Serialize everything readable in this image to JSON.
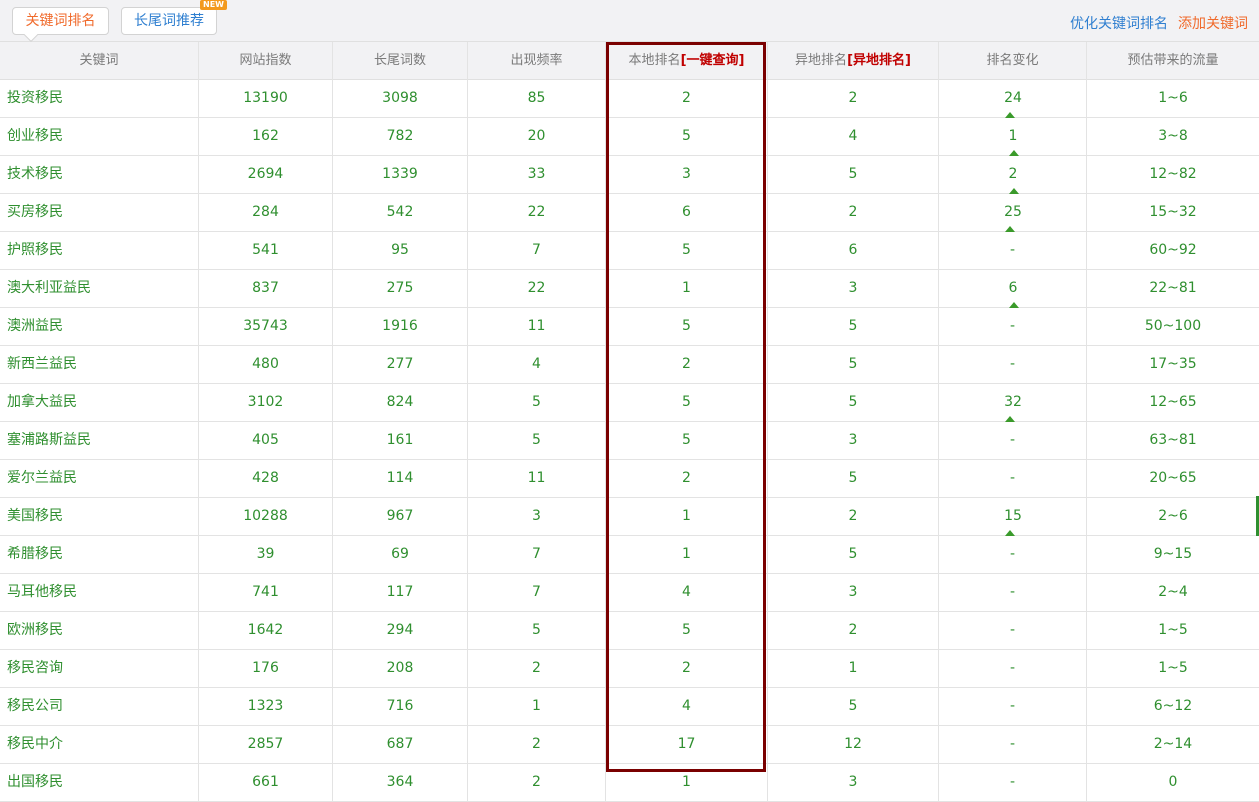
{
  "tabs": [
    {
      "label": "关键词排名",
      "active": true
    },
    {
      "label": "长尾词推荐",
      "badge": "NEW",
      "active": false
    }
  ],
  "top_links": {
    "optimize": "优化关键词排名",
    "add": "添加关键词"
  },
  "columns": [
    {
      "label": "关键词"
    },
    {
      "label": "网站指数"
    },
    {
      "label": "长尾词数"
    },
    {
      "label": "出现频率"
    },
    {
      "label": "本地排名",
      "link": "[一键查询]"
    },
    {
      "label": "异地排名",
      "link": "[异地排名]"
    },
    {
      "label": "排名变化"
    },
    {
      "label": "预估带来的流量"
    }
  ],
  "rows": [
    {
      "kw": "投资移民",
      "index": "13190",
      "longtail": "3098",
      "freq": "85",
      "local": "2",
      "remote": "2",
      "change": "24",
      "up": true,
      "traffic": "1~6"
    },
    {
      "kw": "创业移民",
      "index": "162",
      "longtail": "782",
      "freq": "20",
      "local": "5",
      "remote": "4",
      "change": "1",
      "up": true,
      "traffic": "3~8"
    },
    {
      "kw": "技术移民",
      "index": "2694",
      "longtail": "1339",
      "freq": "33",
      "local": "3",
      "remote": "5",
      "change": "2",
      "up": true,
      "traffic": "12~82"
    },
    {
      "kw": "买房移民",
      "index": "284",
      "longtail": "542",
      "freq": "22",
      "local": "6",
      "remote": "2",
      "change": "25",
      "up": true,
      "traffic": "15~32"
    },
    {
      "kw": "护照移民",
      "index": "541",
      "longtail": "95",
      "freq": "7",
      "local": "5",
      "remote": "6",
      "change": "-",
      "up": false,
      "traffic": "60~92"
    },
    {
      "kw": "澳大利亚益民",
      "index": "837",
      "longtail": "275",
      "freq": "22",
      "local": "1",
      "remote": "3",
      "change": "6",
      "up": true,
      "traffic": "22~81"
    },
    {
      "kw": "澳洲益民",
      "index": "35743",
      "longtail": "1916",
      "freq": "11",
      "local": "5",
      "remote": "5",
      "change": "-",
      "up": false,
      "traffic": "50~100"
    },
    {
      "kw": "新西兰益民",
      "index": "480",
      "longtail": "277",
      "freq": "4",
      "local": "2",
      "remote": "5",
      "change": "-",
      "up": false,
      "traffic": "17~35"
    },
    {
      "kw": "加拿大益民",
      "index": "3102",
      "longtail": "824",
      "freq": "5",
      "local": "5",
      "remote": "5",
      "change": "32",
      "up": true,
      "traffic": "12~65"
    },
    {
      "kw": "塞浦路斯益民",
      "index": "405",
      "longtail": "161",
      "freq": "5",
      "local": "5",
      "remote": "3",
      "change": "-",
      "up": false,
      "traffic": "63~81"
    },
    {
      "kw": "爱尔兰益民",
      "index": "428",
      "longtail": "114",
      "freq": "11",
      "local": "2",
      "remote": "5",
      "change": "-",
      "up": false,
      "traffic": "20~65"
    },
    {
      "kw": "美国移民",
      "index": "10288",
      "longtail": "967",
      "freq": "3",
      "local": "1",
      "remote": "2",
      "change": "15",
      "up": true,
      "traffic": "2~6"
    },
    {
      "kw": "希腊移民",
      "index": "39",
      "longtail": "69",
      "freq": "7",
      "local": "1",
      "remote": "5",
      "change": "-",
      "up": false,
      "traffic": "9~15"
    },
    {
      "kw": "马耳他移民",
      "index": "741",
      "longtail": "117",
      "freq": "7",
      "local": "4",
      "remote": "3",
      "change": "-",
      "up": false,
      "traffic": "2~4"
    },
    {
      "kw": "欧洲移民",
      "index": "1642",
      "longtail": "294",
      "freq": "5",
      "local": "5",
      "remote": "2",
      "change": "-",
      "up": false,
      "traffic": "1~5"
    },
    {
      "kw": "移民咨询",
      "index": "176",
      "longtail": "208",
      "freq": "2",
      "local": "2",
      "remote": "1",
      "change": "-",
      "up": false,
      "traffic": "1~5"
    },
    {
      "kw": "移民公司",
      "index": "1323",
      "longtail": "716",
      "freq": "1",
      "local": "4",
      "remote": "5",
      "change": "-",
      "up": false,
      "traffic": "6~12"
    },
    {
      "kw": "移民中介",
      "index": "2857",
      "longtail": "687",
      "freq": "2",
      "local": "17",
      "remote": "12",
      "change": "-",
      "up": false,
      "traffic": "2~14"
    },
    {
      "kw": "出国移民",
      "index": "661",
      "longtail": "364",
      "freq": "2",
      "local": "1",
      "remote": "3",
      "change": "-",
      "up": false,
      "traffic": "0"
    }
  ]
}
